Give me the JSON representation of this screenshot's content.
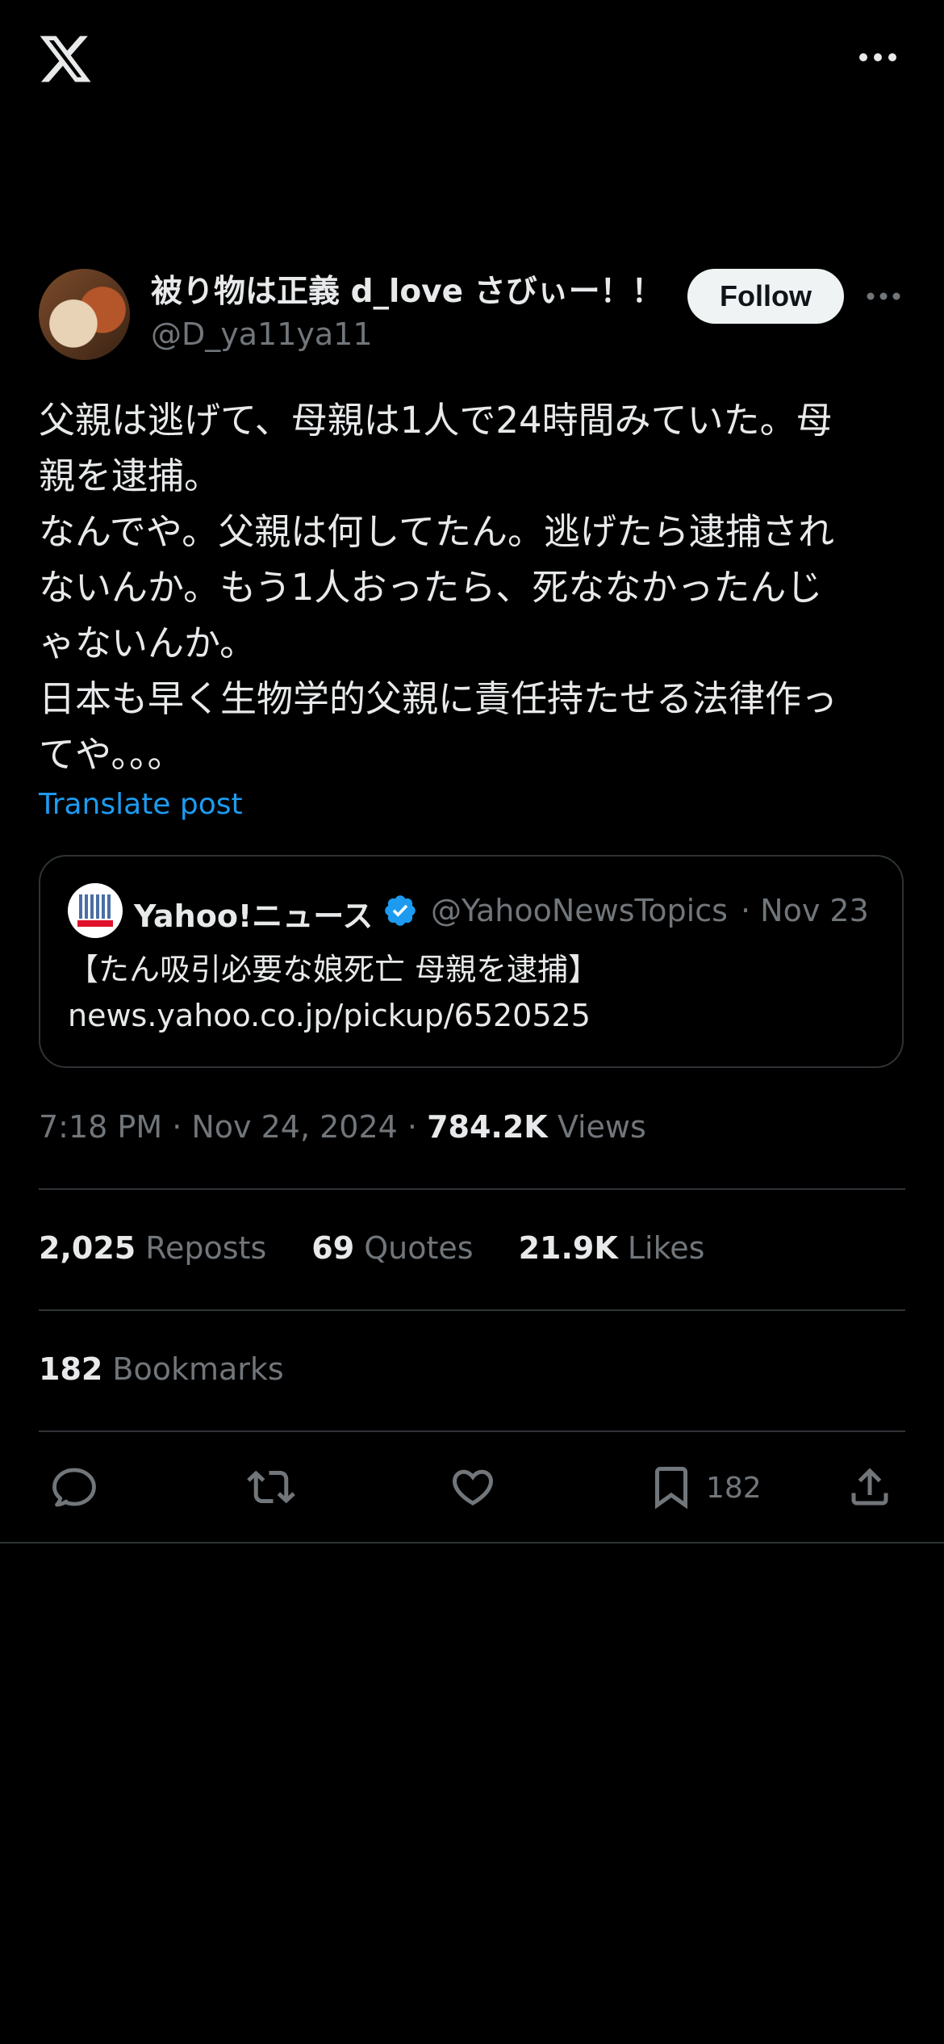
{
  "colors": {
    "background": "#000000",
    "text": "#e7e9ea",
    "secondary": "#71767b",
    "link": "#1d9bf0",
    "divider": "#2f3336",
    "follow_bg": "#eff3f4"
  },
  "top_bar": {
    "logo_icon": "x-logo-icon",
    "more_icon": "more-horizontal-icon"
  },
  "author": {
    "display_name": "被り物は正義 d_love さびぃー！！",
    "handle": "@D_ya11ya11",
    "follow_label": "Follow"
  },
  "post": {
    "text": "父親は逃げて、母親は1人で24時間みていた。母\n親を逮捕。\nなんでや。父親は何してたん。逃げたら逮捕され\nないんか。もう1人おったら、死ななかったんじ\nゃないんか。\n日本も早く生物学的父親に責任持たせる法律作っ\nてや。。。",
    "translate_label": "Translate post"
  },
  "quoted": {
    "name": "Yahoo!ニュース",
    "handle": "@YahooNewsTopics",
    "date": "· Nov 23",
    "text": "【たん吸引必要な娘死亡 母親を逮捕】\nnews.yahoo.co.jp/pickup/6520525",
    "verified_icon": "verified-badge-icon"
  },
  "meta": {
    "time_date": "7:18 PM · Nov 24, 2024 · ",
    "views_count": "784.2K",
    "views_label": "Views"
  },
  "stats": {
    "reposts_count": "2,025",
    "reposts_label": "Reposts",
    "quotes_count": "69",
    "quotes_label": "Quotes",
    "likes_count": "21.9K",
    "likes_label": "Likes"
  },
  "bookmarks": {
    "count": "182",
    "label": "Bookmarks"
  },
  "actions": {
    "reply_icon": "reply-icon",
    "repost_icon": "repost-icon",
    "like_icon": "heart-icon",
    "bookmark_icon": "bookmark-icon",
    "bookmark_count": "182",
    "share_icon": "share-icon"
  }
}
